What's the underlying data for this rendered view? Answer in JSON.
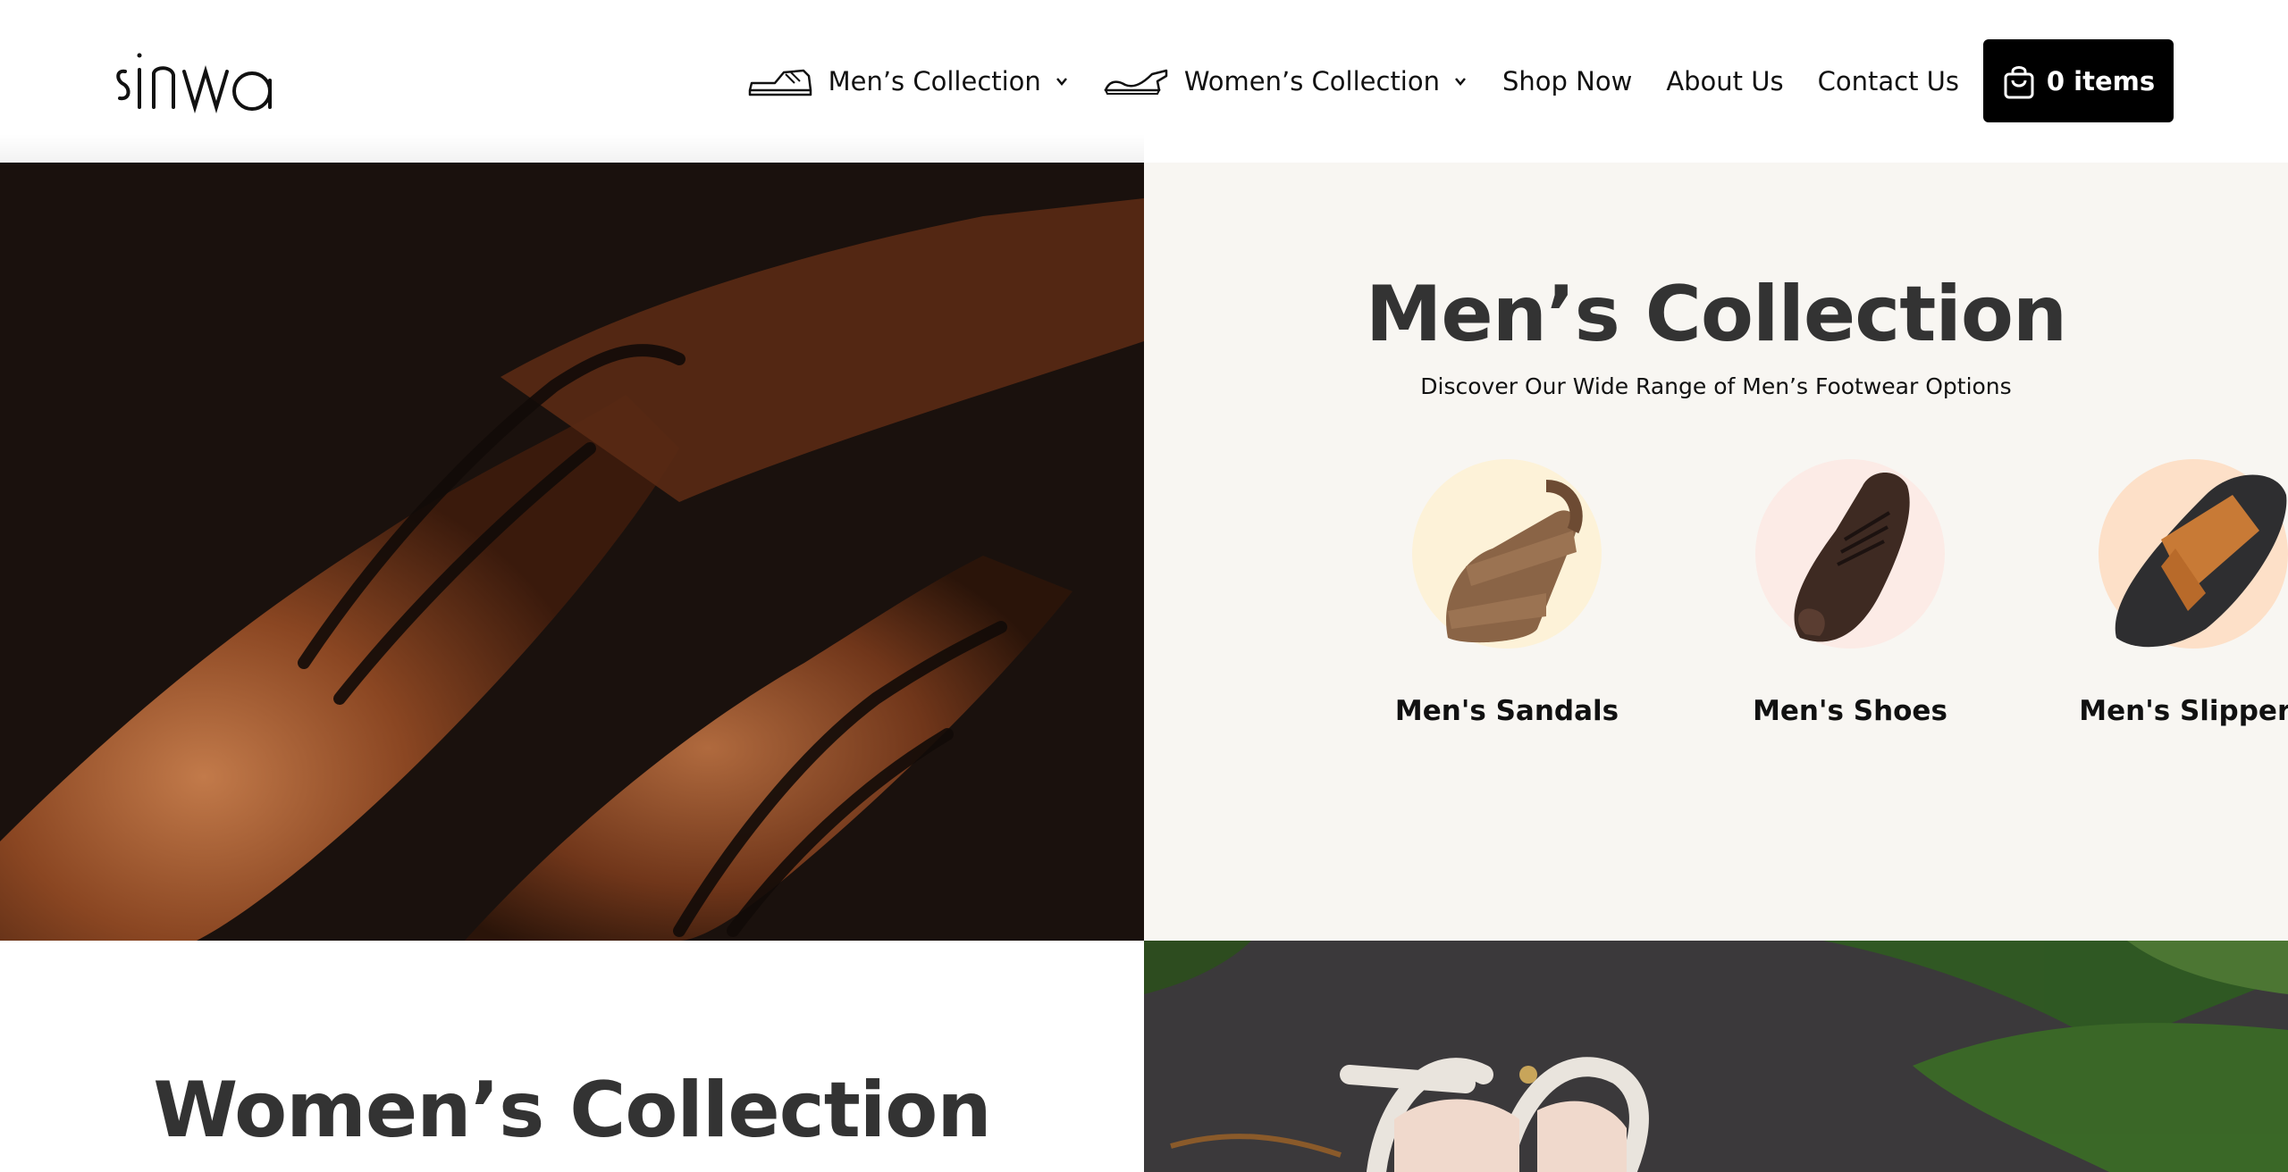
{
  "brand": {
    "logo_text": "sinwa"
  },
  "nav": {
    "items": [
      {
        "label": "Men’s Collection",
        "icon": "mens-shoe-icon",
        "dropdown": true
      },
      {
        "label": "Women’s Collection",
        "icon": "womens-shoe-icon",
        "dropdown": true
      },
      {
        "label": "Shop Now"
      },
      {
        "label": "About Us"
      },
      {
        "label": "Contact Us"
      }
    ],
    "cart": {
      "label": "0 items",
      "icon": "shopping-bag-icon"
    }
  },
  "mens_section": {
    "title": "Men’s Collection",
    "subtitle": "Discover Our Wide Range of Men’s Footwear Options",
    "categories": [
      {
        "label": "Men's Sandals",
        "circle_color": "#fdf2d8"
      },
      {
        "label": "Men's Shoes",
        "circle_color": "#fcebe6"
      },
      {
        "label": "Men's Slippers",
        "circle_color": "#fde0c8"
      }
    ]
  },
  "womens_section": {
    "title": "Women’s Collection"
  }
}
